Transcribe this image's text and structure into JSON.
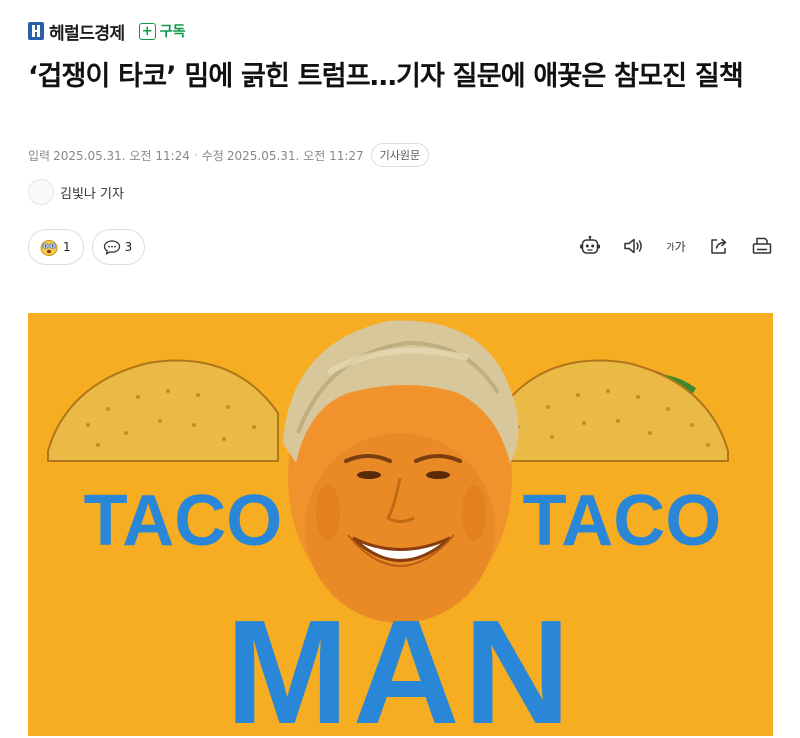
{
  "publisher": {
    "name": "헤럴드경제",
    "subscribe_label": "구독"
  },
  "article": {
    "title": "‘겁쟁이 타코’ 밈에 긁힌 트럼프…기자 질문에 애꿎은 참모진 질책",
    "published_label": "입력",
    "published": "2025.05.31. 오전 11:24",
    "modified_label": "수정",
    "modified": "2025.05.31. 오전 11:27",
    "original_link_label": "기사원문",
    "reporter": "김빛나 기자"
  },
  "reactions": {
    "emotion_count": "1",
    "comment_count": "3"
  },
  "toolbar": {
    "icons": [
      "summary-bot-icon",
      "audio-speaker-icon",
      "font-size-icon",
      "share-icon",
      "print-icon"
    ],
    "font_small": "가",
    "font_large": "가"
  },
  "hero": {
    "text_left": "TACO",
    "text_right": "TACO",
    "text_bottom": "MAN",
    "colors": {
      "background": "#f5a91c",
      "text": "#2a86d6"
    }
  }
}
